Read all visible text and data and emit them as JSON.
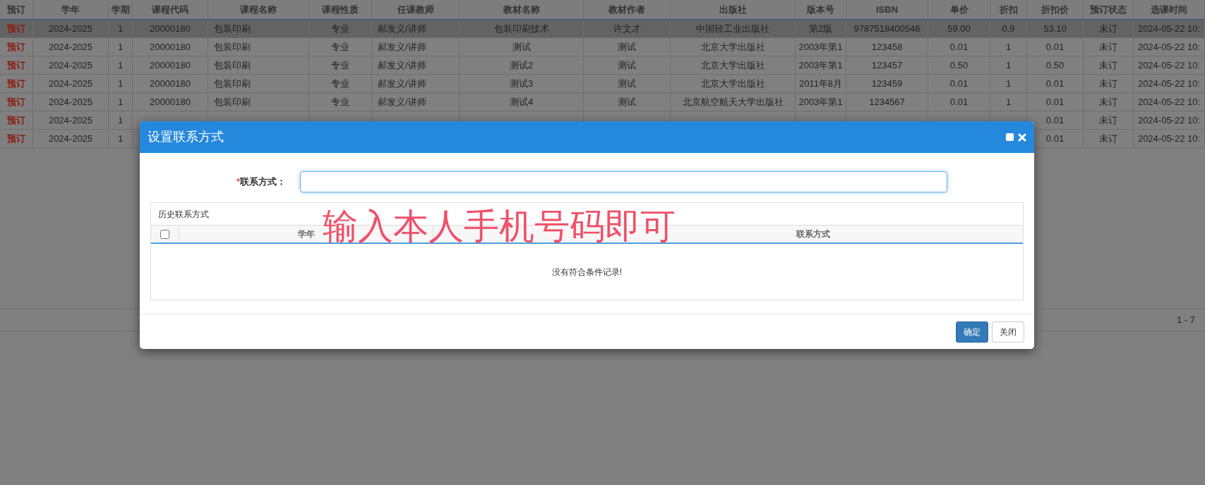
{
  "table": {
    "columns": [
      "预订",
      "学年",
      "学期",
      "课程代码",
      "课程名称",
      "课程性质",
      "任课教师",
      "教材名称",
      "教材作者",
      "出版社",
      "版本号",
      "ISBN",
      "单价",
      "折扣",
      "折扣价",
      "预订状态",
      "选课时间"
    ],
    "rows": [
      {
        "selected": true,
        "cells": [
          "预订",
          "2024-2025",
          "1",
          "20000180",
          "包装印刷",
          "专业",
          "郝发义/讲师",
          "包装印刷技术",
          "许文才",
          "中国轻工业出版社",
          "第2版",
          "9787518400546",
          "59.00",
          "0.9",
          "53.10",
          "未订",
          "2024-05-22 10:"
        ]
      },
      {
        "selected": false,
        "cells": [
          "预订",
          "2024-2025",
          "1",
          "20000180",
          "包装印刷",
          "专业",
          "郝发义/讲师",
          "测试",
          "测试",
          "北京大学出版社",
          "2003年第1",
          "123458",
          "0.01",
          "1",
          "0.01",
          "未订",
          "2024-05-22 10:"
        ]
      },
      {
        "selected": false,
        "cells": [
          "预订",
          "2024-2025",
          "1",
          "20000180",
          "包装印刷",
          "专业",
          "郝发义/讲师",
          "测试2",
          "测试",
          "北京大学出版社",
          "2003年第1",
          "123457",
          "0.50",
          "1",
          "0.50",
          "未订",
          "2024-05-22 10:"
        ]
      },
      {
        "selected": false,
        "cells": [
          "预订",
          "2024-2025",
          "1",
          "20000180",
          "包装印刷",
          "专业",
          "郝发义/讲师",
          "测试3",
          "测试",
          "北京大学出版社",
          "2011年8月",
          "123459",
          "0.01",
          "1",
          "0.01",
          "未订",
          "2024-05-22 10:"
        ]
      },
      {
        "selected": false,
        "cells": [
          "预订",
          "2024-2025",
          "1",
          "20000180",
          "包装印刷",
          "专业",
          "郝发义/讲师",
          "测试4",
          "测试",
          "北京航空航天大学出版社",
          "2003年第1",
          "1234567",
          "0.01",
          "1",
          "0.01",
          "未订",
          "2024-05-22 10:"
        ]
      },
      {
        "selected": false,
        "cells": [
          "预订",
          "2024-2025",
          "1",
          null,
          null,
          null,
          null,
          null,
          null,
          null,
          null,
          null,
          null,
          null,
          "0.01",
          "未订",
          "2024-05-22 10:"
        ]
      },
      {
        "selected": false,
        "cells": [
          "预订",
          "2024-2025",
          "1",
          null,
          null,
          null,
          null,
          null,
          null,
          null,
          null,
          null,
          null,
          null,
          "0.01",
          "未订",
          "2024-05-22 10:"
        ]
      }
    ]
  },
  "pagination": {
    "text": "1 - 7"
  },
  "dialog": {
    "title": "设置联系方式",
    "field": {
      "required_mark": "*",
      "label": "联系方式："
    },
    "history": {
      "title": "历史联系方式",
      "select_all_checked": false,
      "columns": [
        "学年",
        "联系方式"
      ],
      "empty_message": "没有符合条件记录!"
    },
    "buttons": [
      {
        "label": "确定",
        "kind": "primary"
      },
      {
        "label": "关闭",
        "kind": "default"
      }
    ]
  },
  "annotation": "输入本人手机号码即可"
}
